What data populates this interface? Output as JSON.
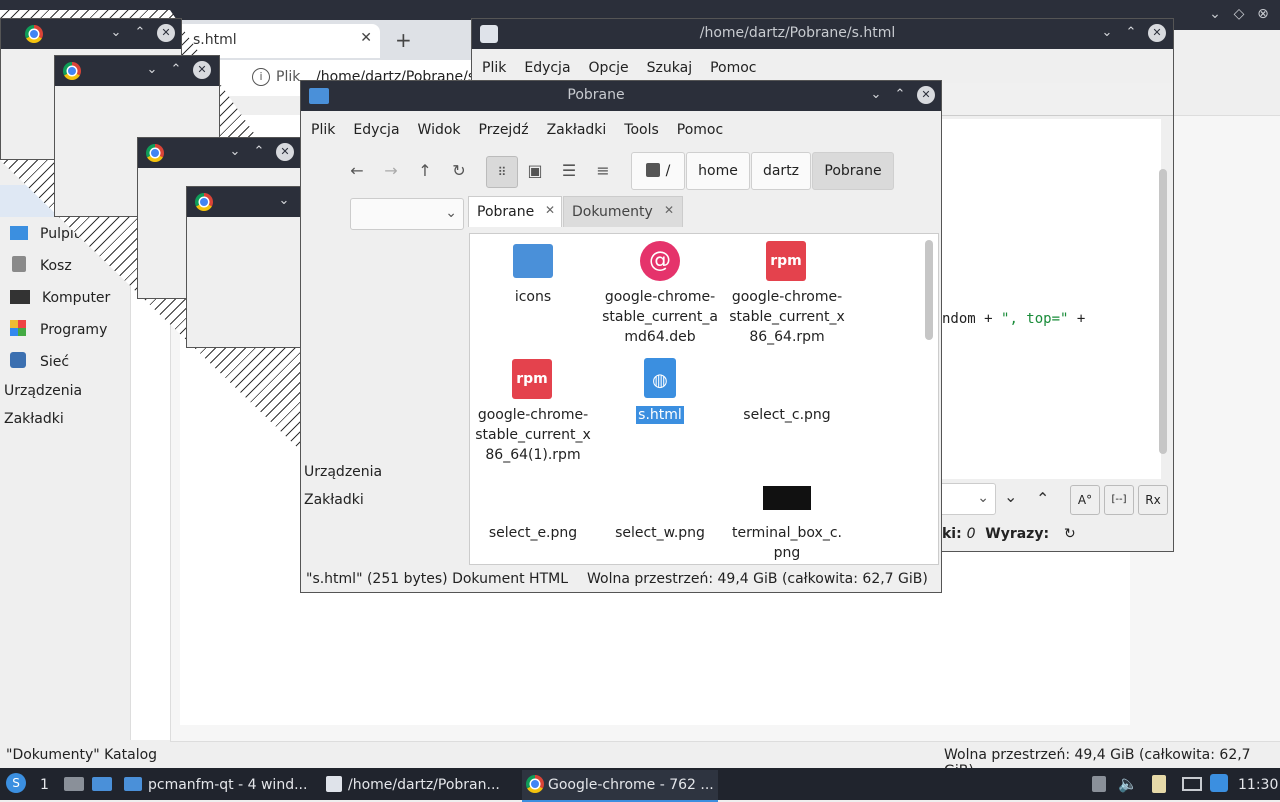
{
  "top_bar": {
    "glyphs": [
      "⌄",
      "◇",
      "⊗"
    ]
  },
  "bg_sidebar": {
    "items": [
      {
        "label": "Pulpit",
        "icon": "desktop-icon"
      },
      {
        "label": "Kosz",
        "icon": "trash-icon"
      },
      {
        "label": "Komputer",
        "icon": "computer-icon"
      },
      {
        "label": "Programy",
        "icon": "apps-icon"
      },
      {
        "label": "Sieć",
        "icon": "network-icon"
      }
    ],
    "sections": [
      "Urządzenia",
      "Zakładki"
    ]
  },
  "bg_status": {
    "left": "\"Dokumenty\" Katalog",
    "right": "Wolna przestrzeń: 49,4 GiB (całkowita: 62,7 GiB)"
  },
  "chrome": {
    "tab_title": "s.html",
    "address": "/home/dartz/Pobrane/s",
    "address_prefix": "Plik"
  },
  "editor": {
    "title": "/home/dartz/Pobrane/s.html",
    "menu": [
      "Plik",
      "Edycja",
      "Opcje",
      "Szukaj",
      "Pomoc"
    ],
    "code_tail_plain": "ndom + ",
    "code_tail_str": "\", top=\"",
    "code_tail_end": " +",
    "stats_label_a": "ki:",
    "stats_value_a": "0",
    "stats_label_b": "Wyrazy:",
    "find_buttons": [
      "A°",
      "[--]",
      "Rx"
    ]
  },
  "fm": {
    "title": "Pobrane",
    "menu": [
      "Plik",
      "Edycja",
      "Widok",
      "Przejdź",
      "Zakładki",
      "Tools",
      "Pomoc"
    ],
    "crumbs": [
      "/",
      "home",
      "dartz",
      "Pobrane"
    ],
    "tabs": [
      "Pobrane",
      "Dokumenty"
    ],
    "sidebar_sections": [
      "Urządzenia",
      "Zakładki"
    ],
    "files": [
      {
        "name": "icons",
        "type": "folder"
      },
      {
        "name": "google-chrome-stable_current_amd64.deb",
        "type": "deb",
        "lines": [
          "google-chrome-",
          "stable_current_a",
          "md64.deb"
        ]
      },
      {
        "name": "google-chrome-stable_current_x86_64.rpm",
        "type": "rpm",
        "lines": [
          "google-chrome-",
          "stable_current_x",
          "86_64.rpm"
        ]
      },
      {
        "name": "google-chrome-stable_current_x86_64(1).rpm",
        "type": "rpm",
        "lines": [
          "google-chrome-",
          "stable_current_x",
          "86_64(1).rpm"
        ]
      },
      {
        "name": "s.html",
        "type": "html",
        "selected": true
      },
      {
        "name": "select_c.png",
        "type": "image-empty"
      },
      {
        "name": "select_e.png",
        "type": "image-empty"
      },
      {
        "name": "select_w.png",
        "type": "image-empty"
      },
      {
        "name": "terminal_box_c.png",
        "type": "image-black",
        "lines": [
          "terminal_box_c.",
          "png"
        ]
      }
    ],
    "rpm_label": "rpm",
    "status_left": "\"s.html\" (251 bytes) Dokument HTML",
    "status_right": "Wolna przestrzeń: 49,4 GiB (całkowita: 62,7 GiB)"
  },
  "taskbar": {
    "workspace": "1",
    "tasks": [
      "pcmanfm-qt - 4 wind...",
      "/home/dartz/Pobran...",
      "Google-chrome - 762 ..."
    ],
    "clock": "11:30"
  },
  "colors": {
    "titlebar": "#2b2f3a",
    "taskbar": "#20242d",
    "accent": "#3b8fe0",
    "rpm": "#e4424d",
    "debian": "#d70a53"
  }
}
